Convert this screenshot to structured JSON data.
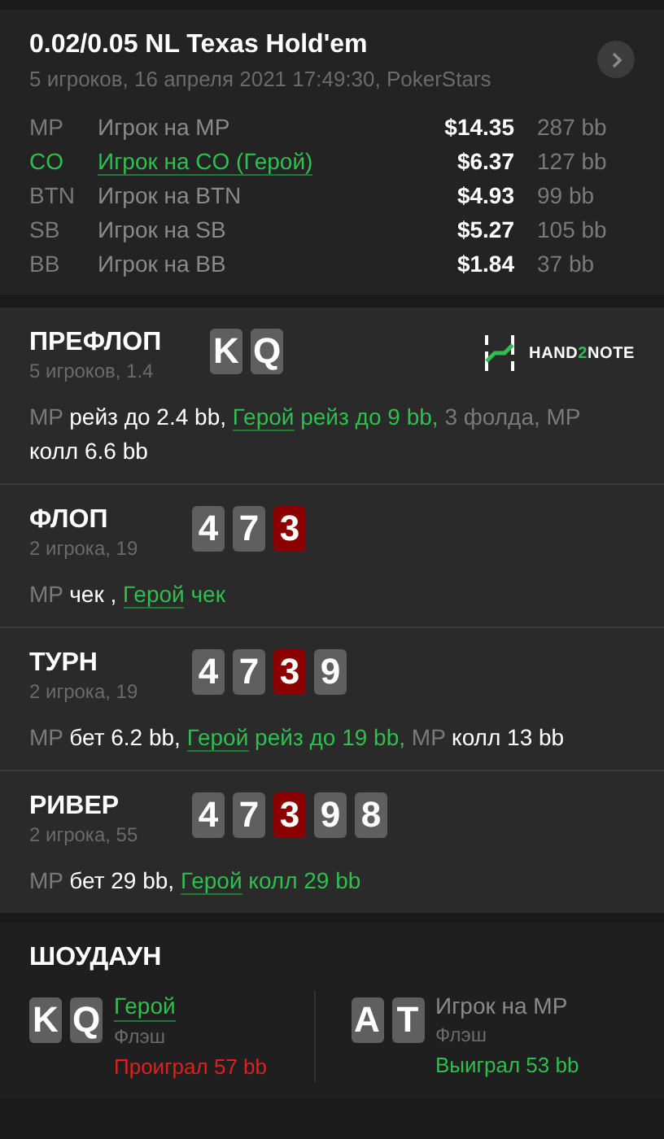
{
  "header": {
    "title": "0.02/0.05 NL Texas Hold'em",
    "subtitle": "5 игроков, 16 апреля 2021 17:49:30, PokerStars"
  },
  "players": [
    {
      "position": "MP",
      "name": "Игрок на MP",
      "hero": false,
      "stack": "$14.35",
      "bb": "287 bb"
    },
    {
      "position": "CO",
      "name": "Игрок на CO (Герой)",
      "hero": true,
      "stack": "$6.37",
      "bb": "127 bb"
    },
    {
      "position": "BTN",
      "name": "Игрок на BTN",
      "hero": false,
      "stack": "$4.93",
      "bb": "99 bb"
    },
    {
      "position": "SB",
      "name": "Игрок на SB",
      "hero": false,
      "stack": "$5.27",
      "bb": "105 bb"
    },
    {
      "position": "BB",
      "name": "Игрок на BB",
      "hero": false,
      "stack": "$1.84",
      "bb": "37 bb"
    }
  ],
  "logo": {
    "parts": [
      "HAND",
      "2",
      "NOTE"
    ]
  },
  "streets": [
    {
      "title": "ПРЕФЛОП",
      "info": "5 игроков, 1.4",
      "logo": true,
      "cards": [
        {
          "rank": "K",
          "color": "#5f5f5f"
        },
        {
          "rank": "Q",
          "color": "#5f5f5f"
        }
      ],
      "actions": [
        {
          "kind": "actor",
          "text": "MP"
        },
        {
          "kind": "action",
          "text": " рейз до 2.4 bb, "
        },
        {
          "kind": "hero",
          "text": "Герой"
        },
        {
          "kind": "hero-action",
          "text": " рейз до 9 bb, "
        },
        {
          "kind": "actor",
          "text": "3 фолда, MP"
        },
        {
          "kind": "action",
          "text": " колл 6.6 bb"
        }
      ]
    },
    {
      "title": "ФЛОП",
      "info": "2 игрока, 19",
      "logo": false,
      "cards": [
        {
          "rank": "4",
          "color": "#5f5f5f"
        },
        {
          "rank": "7",
          "color": "#5f5f5f"
        },
        {
          "rank": "3",
          "color": "#8b0000"
        }
      ],
      "actions": [
        {
          "kind": "actor",
          "text": "MP"
        },
        {
          "kind": "action",
          "text": " чек , "
        },
        {
          "kind": "hero",
          "text": "Герой"
        },
        {
          "kind": "hero-action",
          "text": " чек"
        }
      ]
    },
    {
      "title": "ТУРН",
      "info": "2 игрока, 19",
      "logo": false,
      "cards": [
        {
          "rank": "4",
          "color": "#5f5f5f"
        },
        {
          "rank": "7",
          "color": "#5f5f5f"
        },
        {
          "rank": "3",
          "color": "#8b0000"
        },
        {
          "rank": "9",
          "color": "#5f5f5f"
        }
      ],
      "actions": [
        {
          "kind": "actor",
          "text": "MP"
        },
        {
          "kind": "action",
          "text": " бет 6.2 bb, "
        },
        {
          "kind": "hero",
          "text": "Герой"
        },
        {
          "kind": "hero-action",
          "text": " рейз до 19 bb, "
        },
        {
          "kind": "actor",
          "text": "MP"
        },
        {
          "kind": "action",
          "text": " колл 13 bb"
        }
      ]
    },
    {
      "title": "РИВЕР",
      "info": "2 игрока, 55",
      "logo": false,
      "cards": [
        {
          "rank": "4",
          "color": "#5f5f5f"
        },
        {
          "rank": "7",
          "color": "#5f5f5f"
        },
        {
          "rank": "3",
          "color": "#8b0000"
        },
        {
          "rank": "9",
          "color": "#5f5f5f"
        },
        {
          "rank": "8",
          "color": "#5f5f5f"
        }
      ],
      "actions": [
        {
          "kind": "actor",
          "text": "MP"
        },
        {
          "kind": "action",
          "text": " бет 29 bb, "
        },
        {
          "kind": "hero",
          "text": "Герой"
        },
        {
          "kind": "hero-action",
          "text": " колл 29 bb"
        }
      ]
    }
  ],
  "showdown": {
    "title": "ШОУДАУН",
    "hands": [
      {
        "cards": [
          {
            "rank": "K",
            "color": "#5f5f5f"
          },
          {
            "rank": "Q",
            "color": "#5f5f5f"
          }
        ],
        "name": "Герой",
        "hero": true,
        "hand": "Флэш",
        "result": "Проиграл 57 bb",
        "color": "#e0201f"
      },
      {
        "cards": [
          {
            "rank": "A",
            "color": "#5f5f5f"
          },
          {
            "rank": "T",
            "color": "#5f5f5f"
          }
        ],
        "name": "Игрок на MP",
        "hero": false,
        "hand": "Флэш",
        "result": "Выиграл 53 bb",
        "color": "#2fbf4f"
      }
    ]
  }
}
